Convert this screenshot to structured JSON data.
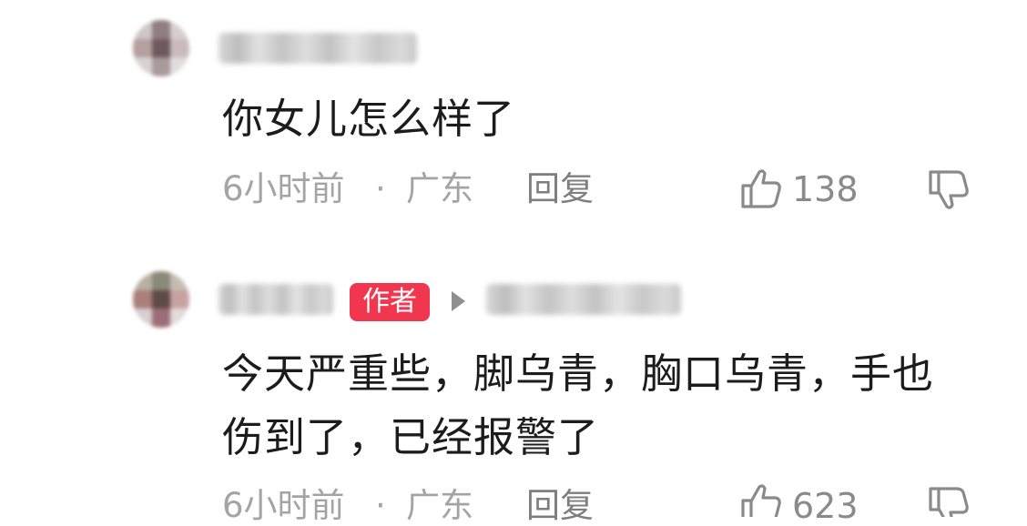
{
  "comments": [
    {
      "text": "你女儿怎么样了",
      "time": "6小时前",
      "separator": "·",
      "location": "广东",
      "reply_label": "回复",
      "like_count": "138"
    },
    {
      "author_badge": "作者",
      "text_line1": "今天严重些，脚乌青，胸口乌青，手也",
      "text_line2": "伤到了，已经报警了",
      "time": "6小时前",
      "separator": "·",
      "location": "广东",
      "reply_label": "回复",
      "like_count": "623"
    }
  ],
  "icons": {
    "like": "thumbs-up-icon",
    "dislike": "thumbs-down-icon",
    "reply_arrow": "play-arrow-icon"
  },
  "colors": {
    "badge": "#f0374f",
    "comment_text": "#1c1c1c",
    "meta_text": "#a4a4a4"
  }
}
